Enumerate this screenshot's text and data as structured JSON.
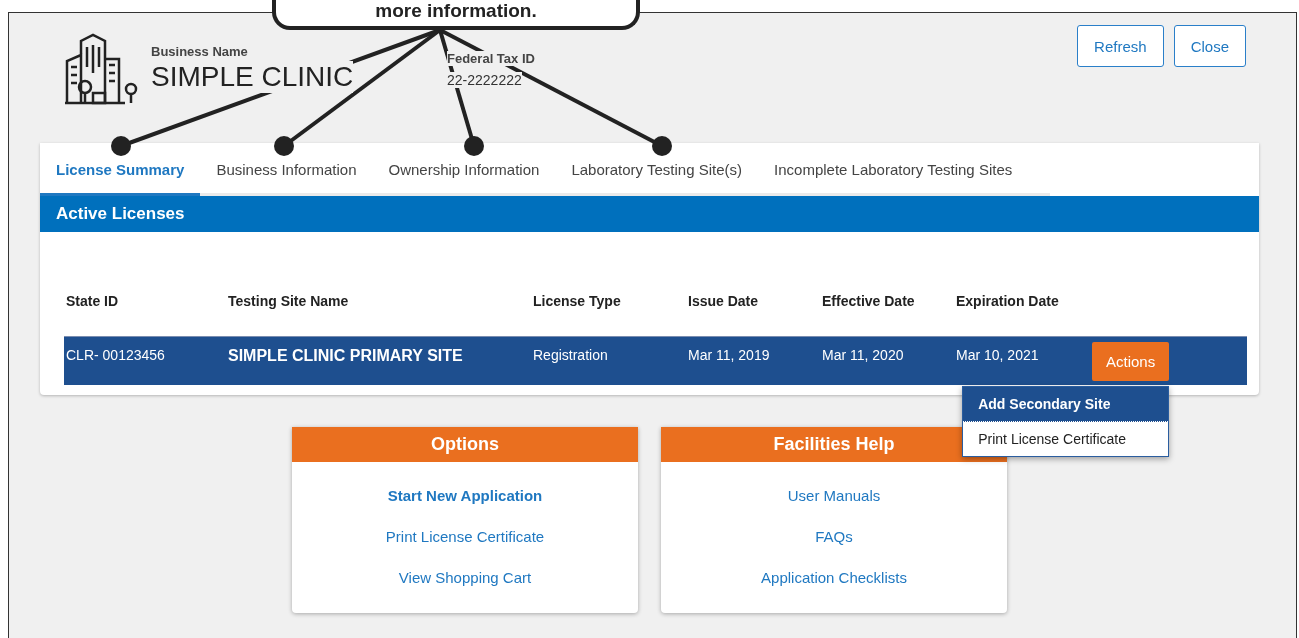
{
  "callout": {
    "text": "more information."
  },
  "header": {
    "business_name_label": "Business Name",
    "business_name": "SIMPLE CLINIC",
    "tax_id_label": "Federal Tax ID",
    "tax_id": "22-2222222"
  },
  "buttons": [
    "Refresh",
    "Close"
  ],
  "tabs": [
    {
      "label": "License Summary",
      "selected": true
    },
    {
      "label": "Business Information",
      "selected": false
    },
    {
      "label": "Ownership Information",
      "selected": false
    },
    {
      "label": "Laboratory Testing Site(s)",
      "selected": false
    },
    {
      "label": "Incomplete Laboratory Testing Sites",
      "selected": false
    }
  ],
  "licenses": {
    "title": "Active Licenses",
    "columns": [
      "State ID",
      "Testing Site Name",
      "License Type",
      "Issue Date",
      "Effective Date",
      "Expiration Date"
    ],
    "rows": [
      {
        "cells": [
          "CLR- 00123456",
          "SIMPLE CLINIC PRIMARY SITE",
          "Registration",
          "Mar 11, 2019",
          "Mar 11, 2020",
          "Mar 10, 2021"
        ],
        "action": "Actions"
      }
    ],
    "menu": [
      {
        "label": "Add Secondary Site",
        "selected": true
      },
      {
        "label": "Print License Certificate",
        "selected": false
      }
    ]
  },
  "cards": [
    {
      "title": "Options",
      "links": [
        {
          "label": "Start New Application",
          "emphasized": true
        },
        {
          "label": "Print License Certificate",
          "emphasized": false
        },
        {
          "label": "View Shopping Cart",
          "emphasized": false
        }
      ]
    },
    {
      "title": "Facilities Help",
      "links": [
        {
          "label": "User Manuals",
          "emphasized": false
        },
        {
          "label": "FAQs",
          "emphasized": false
        },
        {
          "label": "Application Checklists",
          "emphasized": false
        }
      ]
    }
  ]
}
